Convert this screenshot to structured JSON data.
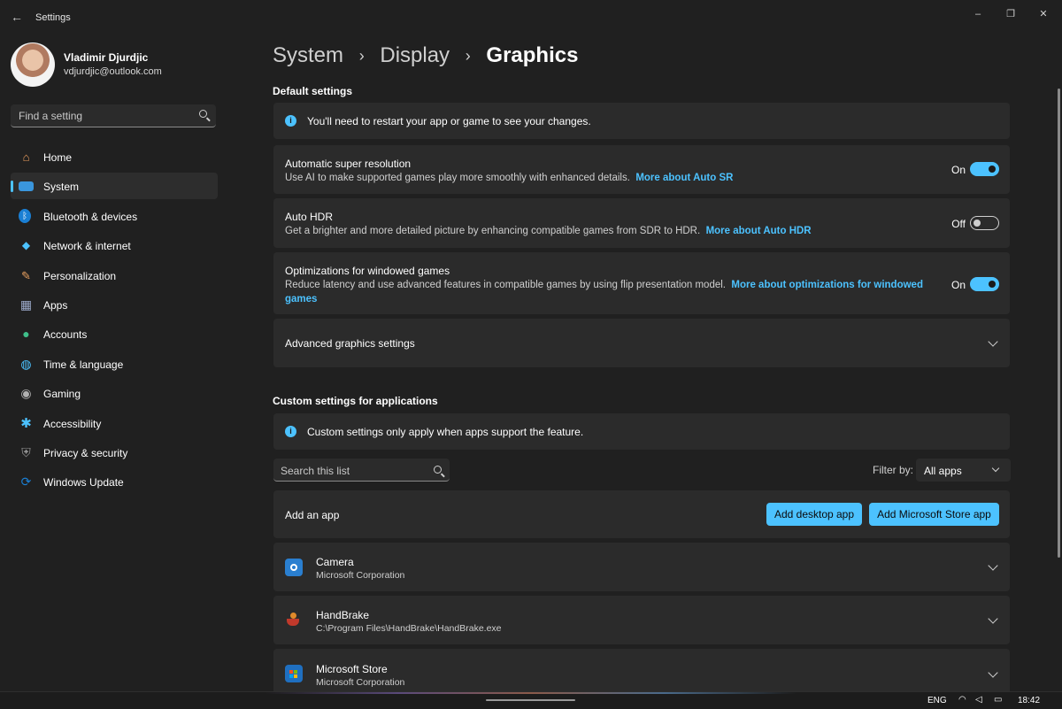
{
  "window": {
    "title": "Settings",
    "back_icon": "back-arrow-icon",
    "controls": {
      "minimize": "–",
      "restore": "❐",
      "close": "✕"
    }
  },
  "profile": {
    "name": "Vladimir Djurdjic",
    "email": "vdjurdjic@outlook.com"
  },
  "search": {
    "placeholder": "Find a setting"
  },
  "nav": {
    "items": [
      {
        "label": "Home",
        "icon": "home-icon",
        "active": false
      },
      {
        "label": "System",
        "icon": "system-icon",
        "active": true
      },
      {
        "label": "Bluetooth & devices",
        "icon": "bluetooth-icon",
        "active": false
      },
      {
        "label": "Network & internet",
        "icon": "wifi-icon",
        "active": false
      },
      {
        "label": "Personalization",
        "icon": "brush-icon",
        "active": false
      },
      {
        "label": "Apps",
        "icon": "apps-icon",
        "active": false
      },
      {
        "label": "Accounts",
        "icon": "accounts-icon",
        "active": false
      },
      {
        "label": "Time & language",
        "icon": "globe-icon",
        "active": false
      },
      {
        "label": "Gaming",
        "icon": "gamepad-icon",
        "active": false
      },
      {
        "label": "Accessibility",
        "icon": "accessibility-icon",
        "active": false
      },
      {
        "label": "Privacy & security",
        "icon": "shield-icon",
        "active": false
      },
      {
        "label": "Windows Update",
        "icon": "update-icon",
        "active": false
      }
    ]
  },
  "breadcrumb": {
    "items": [
      "System",
      "Display",
      "Graphics"
    ],
    "separator": "›"
  },
  "default_settings": {
    "title": "Default settings",
    "info": "You'll need to restart your app or game to see your changes.",
    "auto_sr": {
      "title": "Automatic super resolution",
      "desc": "Use AI to make supported games play more smoothly with enhanced details.",
      "link": "More about Auto SR",
      "state": "On"
    },
    "auto_hdr": {
      "title": "Auto HDR",
      "desc": "Get a brighter and more detailed picture by enhancing compatible games from SDR to HDR.",
      "link": "More about Auto HDR",
      "state": "Off"
    },
    "windowed": {
      "title": "Optimizations for windowed games",
      "desc": "Reduce latency and use advanced features in compatible games by using flip presentation model.",
      "link": "More about optimizations for windowed games",
      "state": "On"
    },
    "advanced": {
      "title": "Advanced graphics settings"
    }
  },
  "custom_settings": {
    "title": "Custom settings for applications",
    "info": "Custom settings only apply when apps support the feature.",
    "search_placeholder": "Search this list",
    "filter_label": "Filter by:",
    "filter_value": "All apps",
    "add_app_label": "Add an app",
    "add_desktop_label": "Add desktop app",
    "add_store_label": "Add Microsoft Store app",
    "apps": [
      {
        "name": "Camera",
        "publisher": "Microsoft Corporation",
        "icon": "camera-icon"
      },
      {
        "name": "HandBrake",
        "publisher": "C:\\Program Files\\HandBrake\\HandBrake.exe",
        "icon": "handbrake-icon"
      },
      {
        "name": "Microsoft Store",
        "publisher": "Microsoft Corporation",
        "icon": "store-icon"
      }
    ]
  },
  "taskbar": {
    "language": "ENG",
    "time": "18:42"
  },
  "colors": {
    "accent": "#4cc2ff",
    "background": "#202020",
    "card": "#2b2b2b"
  }
}
